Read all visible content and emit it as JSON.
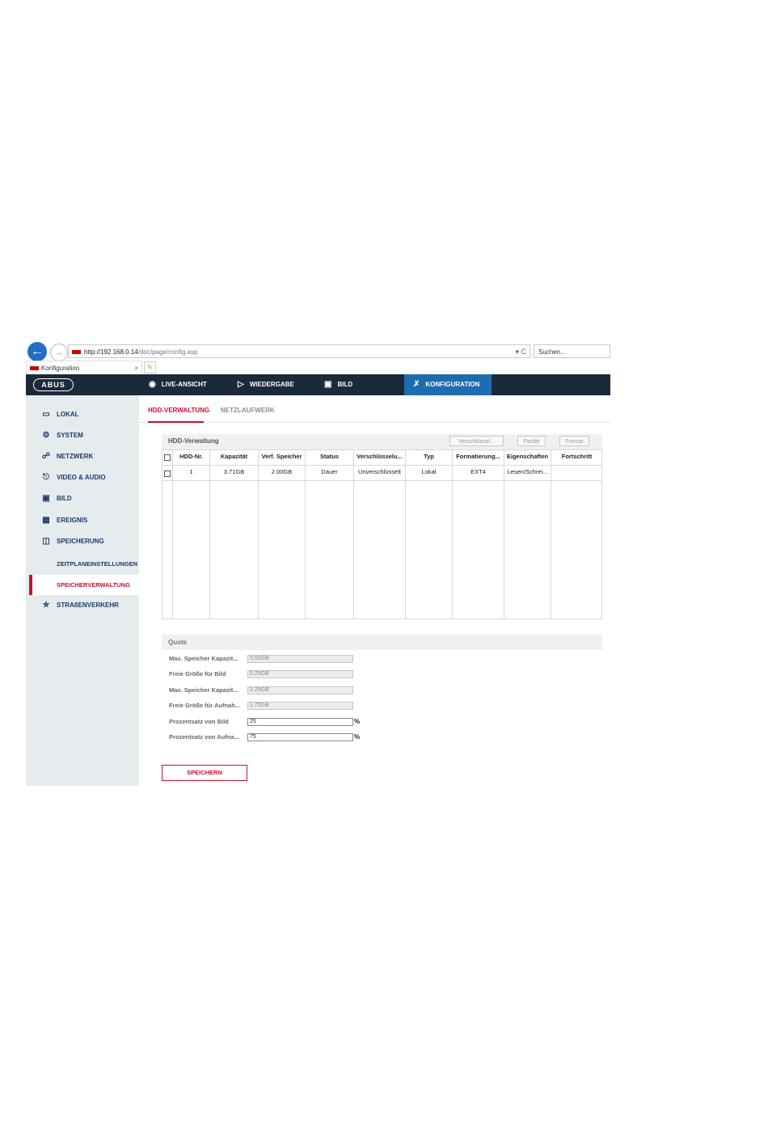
{
  "browser": {
    "url_host": "http://192.168.0.14",
    "url_path": "/doc/page/config.asp",
    "url_controls": "▾ C",
    "search_placeholder": "Suchen...",
    "tab_title": "Konfiguration",
    "tab_close": "×"
  },
  "logo": "ABUS",
  "topnav": {
    "live": "LIVE-ANSICHT",
    "playback": "WIEDERGABE",
    "image": "BILD",
    "config": "KONFIGURATION"
  },
  "sidebar": {
    "items": [
      {
        "label": "LOKAL",
        "icon": "monitor-icon"
      },
      {
        "label": "SYSTEM",
        "icon": "gear-icon"
      },
      {
        "label": "NETZWERK",
        "icon": "network-icon"
      },
      {
        "label": "VIDEO & AUDIO",
        "icon": "microphone-icon"
      },
      {
        "label": "BILD",
        "icon": "image-icon"
      },
      {
        "label": "EREIGNIS",
        "icon": "calendar-icon"
      },
      {
        "label": "SPEICHERUNG",
        "icon": "floppy-icon"
      }
    ],
    "subitems": [
      {
        "label": "ZEITPLANEINSTELLUNGEN"
      },
      {
        "label": "SPEICHERVERWALTUNG",
        "active": true
      }
    ],
    "traffic": {
      "label": "STRAßENVERKEHR",
      "icon": "car-search-icon"
    }
  },
  "subtabs": {
    "hdd": "HDD-VERWALTUNG",
    "nas": "NETZLAUFWERK"
  },
  "hdd": {
    "title": "HDD-Verwaltung",
    "buttons": {
      "encrypt": "Verschlüssel...",
      "parity": "Parität",
      "format": "Format"
    },
    "columns": [
      "HDD-Nr.",
      "Kapazität",
      "Verf. Speicher",
      "Status",
      "Verschlüsselu...",
      "Typ",
      "Formatierung...",
      "Eigenschaften",
      "Fortschritt"
    ],
    "rows": [
      [
        "1",
        "3.71GB",
        "2.00GB",
        "Dauer",
        "Unverschlüsselt",
        "Lokal",
        "EXT4",
        "Lesen/Schrei...",
        ""
      ]
    ]
  },
  "quota": {
    "title": "Quote",
    "fields": [
      {
        "label": "Max. Speicher Kapazit...",
        "value": "0.50GB"
      },
      {
        "label": "Freie Größe für Bild",
        "value": "0.25GB"
      },
      {
        "label": "Max. Speicher Kapazit...",
        "value": "2.25GB"
      },
      {
        "label": "Freie Größe für Aufnah...",
        "value": "1.75GB"
      },
      {
        "label": "Prozentsatz von Bild",
        "value": "25",
        "unit": "%"
      },
      {
        "label": "Prozentsatz von Aufna...",
        "value": "75",
        "unit": "%"
      }
    ]
  },
  "save_label": "SPEICHERN",
  "colors": {
    "nav_bg": "#1b2a3a",
    "nav_active": "#1e6cb0",
    "accent_red": "#c8102e",
    "sidebar_bg": "#e6ebee",
    "sidebar_text": "#1c3a66"
  }
}
